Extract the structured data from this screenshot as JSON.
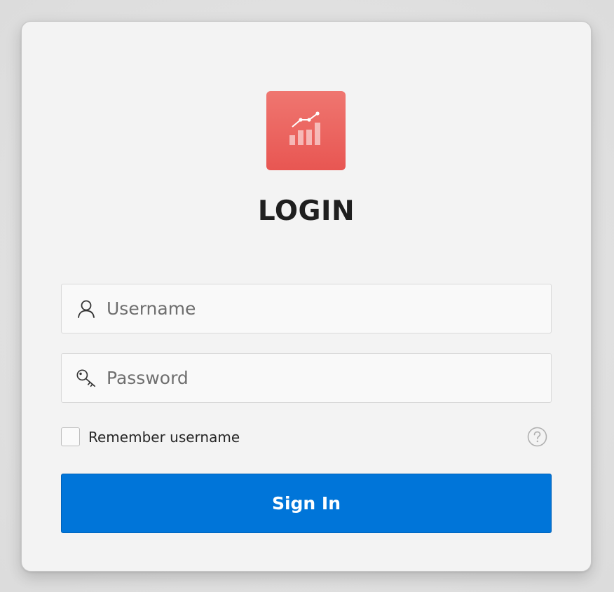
{
  "logo": {
    "icon": "chart-growth-icon",
    "color": "#ea6460"
  },
  "title": "LOGIN",
  "username": {
    "icon": "user-icon",
    "placeholder": "Username",
    "value": ""
  },
  "password": {
    "icon": "key-icon",
    "placeholder": "Password",
    "value": ""
  },
  "remember": {
    "label": "Remember username",
    "checked": false
  },
  "help": {
    "icon": "help-circle-icon"
  },
  "signin": {
    "label": "Sign In",
    "color": "#0075d9"
  }
}
